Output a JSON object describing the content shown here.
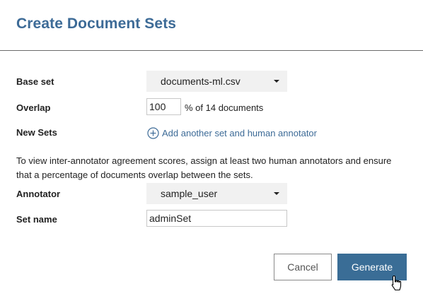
{
  "dialog": {
    "title": "Create Document Sets"
  },
  "form": {
    "base_set_label": "Base set",
    "base_set_value": "documents-ml.csv",
    "overlap_label": "Overlap",
    "overlap_value": "100",
    "overlap_suffix": "% of 14 documents",
    "new_sets_label": "New Sets",
    "add_set_link": "Add another set and human annotator",
    "note": "To view inter-annotator agreement scores, assign at least two human annotators and ensure that a percentage of documents overlap between the sets.",
    "annotator_label": "Annotator",
    "annotator_value": "sample_user",
    "set_name_label": "Set name",
    "set_name_value": "adminSet"
  },
  "actions": {
    "cancel_label": "Cancel",
    "generate_label": "Generate"
  },
  "colors": {
    "accent": "#3d6b97",
    "primary_button": "#3a6d96",
    "select_bg": "#f1f1f1"
  },
  "icons": {
    "add_icon": "plus-circle-icon",
    "dropdown_icon": "caret-down-icon",
    "cursor_icon": "hand-pointer-icon"
  }
}
